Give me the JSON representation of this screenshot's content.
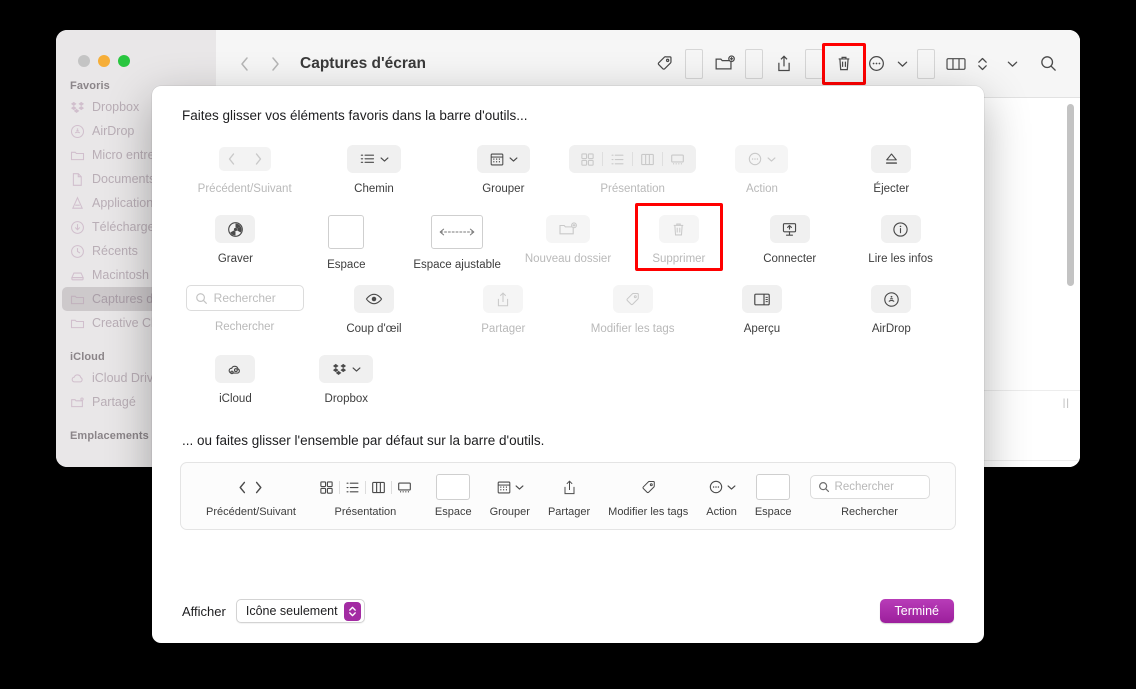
{
  "window": {
    "title": "Captures d'écran",
    "traffic_lights": [
      "close",
      "minimize",
      "maximize"
    ],
    "nav": {
      "back": "‹",
      "forward": "›"
    },
    "toolbar_icons": [
      {
        "name": "tag-icon",
        "highlighted": false
      },
      {
        "name": "flexible-space-placeholder",
        "highlighted": false
      },
      {
        "name": "new-folder-icon",
        "highlighted": false
      },
      {
        "name": "flexible-space-placeholder",
        "highlighted": false
      },
      {
        "name": "share-icon",
        "highlighted": false
      },
      {
        "name": "flexible-space-placeholder",
        "highlighted": false
      },
      {
        "name": "trash-icon",
        "highlighted": true
      },
      {
        "name": "action-menu-icon",
        "highlighted": false
      },
      {
        "name": "flexible-space-placeholder",
        "highlighted": false
      },
      {
        "name": "column-view-icon",
        "highlighted": false
      },
      {
        "name": "chevron-down-icon",
        "highlighted": false
      },
      {
        "name": "search-icon",
        "highlighted": false
      }
    ]
  },
  "sidebar": {
    "sections": [
      {
        "title": "Favoris",
        "items": [
          {
            "label": "Dropbox",
            "icon": "dropbox-icon",
            "selected": false
          },
          {
            "label": "AirDrop",
            "icon": "airdrop-icon",
            "selected": false
          },
          {
            "label": "Micro entreprise",
            "icon": "folder-icon",
            "selected": false
          },
          {
            "label": "Documents",
            "icon": "document-icon",
            "selected": false
          },
          {
            "label": "Applications",
            "icon": "applications-icon",
            "selected": false
          },
          {
            "label": "Téléchargements",
            "icon": "downloads-icon",
            "selected": false
          },
          {
            "label": "Récents",
            "icon": "clock-icon",
            "selected": false
          },
          {
            "label": "Macintosh HD",
            "icon": "disk-icon",
            "selected": false
          },
          {
            "label": "Captures d'écran",
            "icon": "folder-icon",
            "selected": true
          },
          {
            "label": "Creative Cloud Files",
            "icon": "folder-icon",
            "selected": false
          }
        ]
      },
      {
        "title": "iCloud",
        "items": [
          {
            "label": "iCloud Drive",
            "icon": "cloud-icon",
            "selected": false
          },
          {
            "label": "Partagé",
            "icon": "shared-folder-icon",
            "selected": false
          }
        ]
      },
      {
        "title": "Emplacements",
        "items": []
      }
    ]
  },
  "sheet": {
    "title": "Faites glisser vos éléments favoris dans la barre d'outils...",
    "subtitle": "... ou faites glisser l'ensemble par défaut sur la barre d'outils.",
    "palette_rows": [
      [
        {
          "label": "Précédent/Suivant",
          "icon": "back-forward-icon",
          "disabled": true,
          "highlighted": false,
          "chip": "plain"
        },
        {
          "label": "Chemin",
          "icon": "path-icon",
          "disabled": false,
          "highlighted": false,
          "chip": "menu"
        },
        {
          "label": "Grouper",
          "icon": "group-icon",
          "disabled": false,
          "highlighted": false,
          "chip": "menu"
        },
        {
          "label": "Présentation",
          "icon": "view-modes-icon",
          "disabled": true,
          "highlighted": false,
          "chip": "segmented"
        },
        {
          "label": "Action",
          "icon": "action-menu-icon",
          "disabled": true,
          "highlighted": false,
          "chip": "menu"
        },
        {
          "label": "Éjecter",
          "icon": "eject-icon",
          "disabled": false,
          "highlighted": false,
          "chip": "normal"
        }
      ],
      [
        {
          "label": "Graver",
          "icon": "burn-icon",
          "disabled": false,
          "highlighted": false,
          "chip": "normal"
        },
        {
          "label": "Espace",
          "icon": "space-icon",
          "disabled": false,
          "highlighted": false,
          "chip": "outline"
        },
        {
          "label": "Espace ajustable",
          "icon": "flexible-space-icon",
          "disabled": false,
          "highlighted": false,
          "chip": "outline"
        },
        {
          "label": "Nouveau dossier",
          "icon": "new-folder-icon",
          "disabled": true,
          "highlighted": false,
          "chip": "normal"
        },
        {
          "label": "Supprimer",
          "icon": "trash-icon",
          "disabled": true,
          "highlighted": true,
          "chip": "normal"
        },
        {
          "label": "Connecter",
          "icon": "connect-server-icon",
          "disabled": false,
          "highlighted": false,
          "chip": "normal"
        },
        {
          "label": "Lire les infos",
          "icon": "info-icon",
          "disabled": false,
          "highlighted": false,
          "chip": "normal"
        }
      ],
      [
        {
          "label": "Rechercher",
          "icon": "search-field-icon",
          "disabled": true,
          "highlighted": false,
          "chip": "search",
          "placeholder": "Rechercher"
        },
        {
          "label": "Coup d'œil",
          "icon": "quicklook-eye-icon",
          "disabled": false,
          "highlighted": false,
          "chip": "normal"
        },
        {
          "label": "Partager",
          "icon": "share-icon",
          "disabled": true,
          "highlighted": false,
          "chip": "normal"
        },
        {
          "label": "Modifier les tags",
          "icon": "tag-icon",
          "disabled": true,
          "highlighted": false,
          "chip": "normal"
        },
        {
          "label": "Aperçu",
          "icon": "preview-pane-icon",
          "disabled": false,
          "highlighted": false,
          "chip": "normal"
        },
        {
          "label": "AirDrop",
          "icon": "airdrop-icon",
          "disabled": false,
          "highlighted": false,
          "chip": "normal"
        }
      ],
      [
        {
          "label": "iCloud",
          "icon": "icloud-share-icon",
          "disabled": false,
          "highlighted": false,
          "chip": "normal"
        },
        {
          "label": "Dropbox",
          "icon": "dropbox-icon",
          "disabled": false,
          "highlighted": false,
          "chip": "menu"
        }
      ]
    ],
    "default_set": [
      {
        "label": "Précédent/Suivant",
        "icon": "back-forward-icon"
      },
      {
        "label": "Présentation",
        "icon": "view-modes-icon"
      },
      {
        "label": "Espace",
        "icon": "space-icon"
      },
      {
        "label": "Grouper",
        "icon": "group-icon"
      },
      {
        "label": "Partager",
        "icon": "share-icon"
      },
      {
        "label": "Modifier les tags",
        "icon": "tag-icon"
      },
      {
        "label": "Action",
        "icon": "action-menu-icon"
      },
      {
        "label": "Espace",
        "icon": "space-icon"
      },
      {
        "label": "Rechercher",
        "icon": "search-field-icon",
        "placeholder": "Rechercher"
      }
    ],
    "footer": {
      "show_label": "Afficher",
      "display_mode": "Icône seulement",
      "done_label": "Terminé"
    }
  },
  "colors": {
    "accent": "#a32ba3",
    "annotation": "#ff0000",
    "sidebar_bg": "#e9e7e8",
    "titlebar_bg": "#f6f6f6"
  }
}
